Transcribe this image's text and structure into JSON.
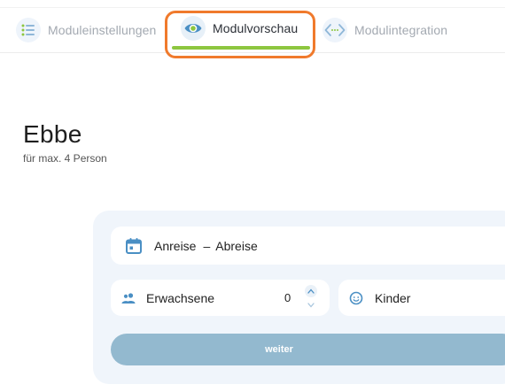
{
  "tabs": [
    {
      "id": "settings",
      "label": "Moduleinstellungen",
      "icon": "list-icon",
      "active": false
    },
    {
      "id": "preview",
      "label": "Modulvorschau",
      "icon": "eye-icon",
      "active": true
    },
    {
      "id": "integration",
      "label": "Modulintegration",
      "icon": "code-icon",
      "active": false
    }
  ],
  "page": {
    "title": "Ebbe",
    "subtitle": "für max. 4 Person"
  },
  "booking": {
    "arrival_label": "Anreise",
    "separator": "–",
    "departure_label": "Abreise",
    "adults_label": "Erwachsene",
    "adults_value": "0",
    "children_label": "Kinder",
    "submit_label": "weiter"
  },
  "colors": {
    "accent_green": "#8dc63f",
    "highlight_orange": "#f07a2c",
    "icon_blue": "#4a8fc4",
    "button_blue": "#93b9cf",
    "widget_bg": "#f0f5fb"
  }
}
